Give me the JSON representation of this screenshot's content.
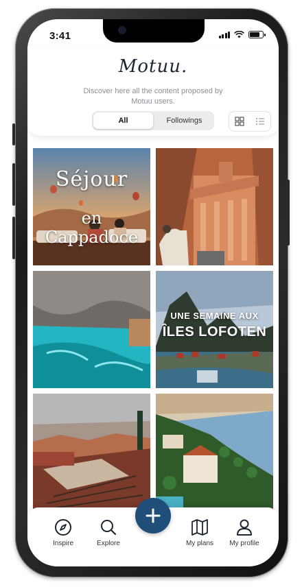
{
  "status_bar": {
    "time": "3:41",
    "battery_level": 0.8
  },
  "header": {
    "logo_text": "Motuu.",
    "tagline": "Discover here all the content proposed by Motuu users.",
    "tabs": [
      {
        "label": "All",
        "active": true
      },
      {
        "label": "Followings",
        "active": false
      }
    ],
    "view_modes": [
      {
        "icon": "grid-icon",
        "active": true
      },
      {
        "icon": "list-icon",
        "active": false
      }
    ]
  },
  "feed": {
    "cards": [
      {
        "caption_line1": "Séjour",
        "caption_line2": "en Cappadoce"
      },
      {
        "caption_line1": "",
        "caption_line2": ""
      },
      {
        "caption_line1": "",
        "caption_line2": ""
      },
      {
        "caption_line1": "UNE SEMAINE AUX",
        "caption_line2": "ÎLES LOFOTEN"
      },
      {
        "caption_line1": "",
        "caption_line2": ""
      },
      {
        "caption_line1": "",
        "caption_line2": ""
      }
    ]
  },
  "bottom_nav": {
    "items": [
      {
        "label": "Inspire",
        "icon": "compass-icon"
      },
      {
        "label": "Explore",
        "icon": "search-icon"
      },
      {
        "label": "My plans",
        "icon": "map-icon"
      },
      {
        "label": "My profile",
        "icon": "user-icon"
      }
    ],
    "fab_icon": "plus-icon"
  },
  "colors": {
    "brand": "#1b2733",
    "fab": "#1f4f78",
    "muted": "#8a8f95"
  }
}
